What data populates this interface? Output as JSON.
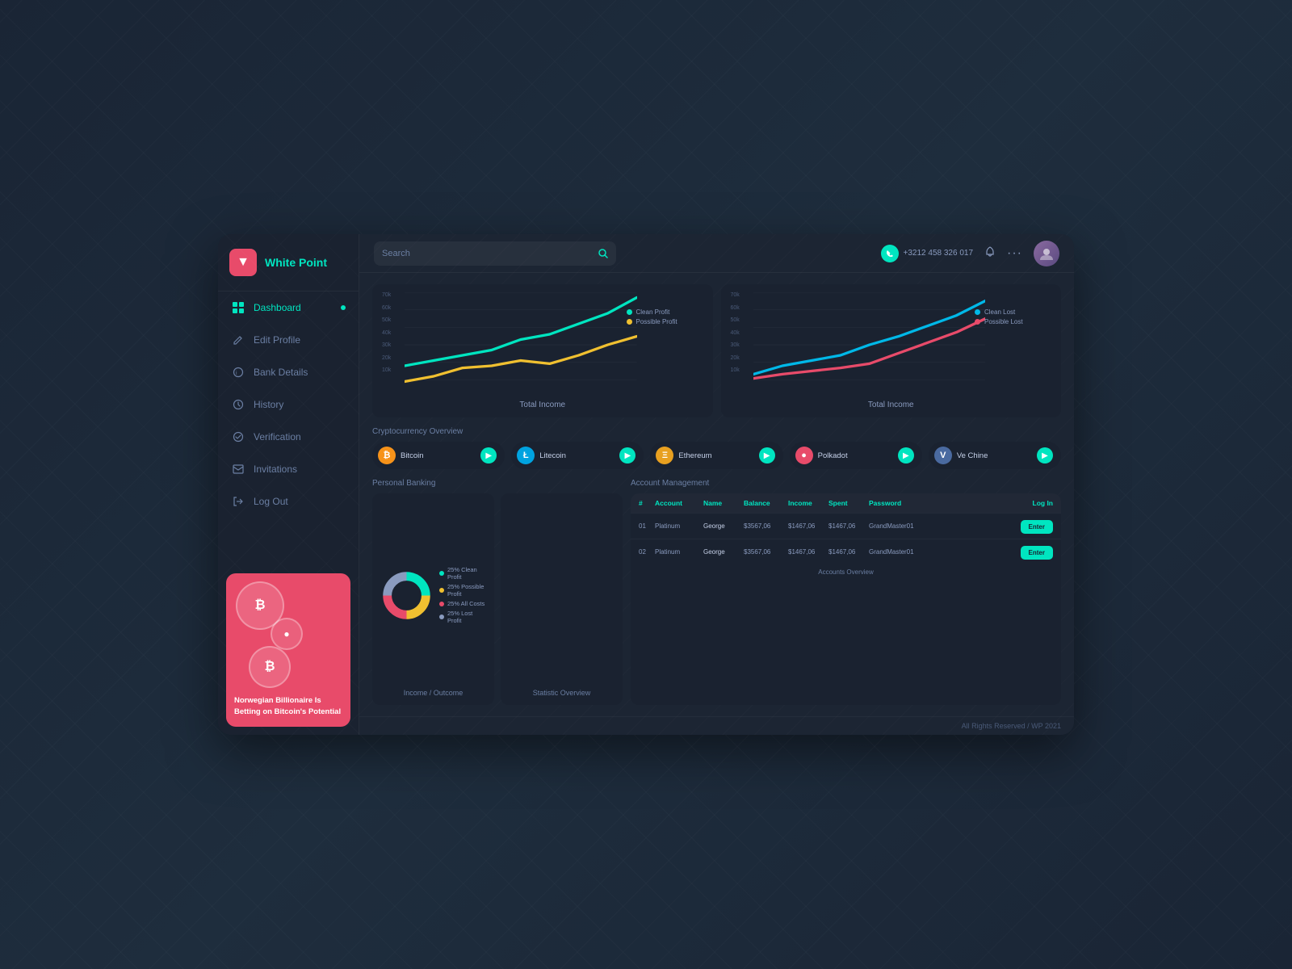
{
  "app": {
    "title": "White Point",
    "logo_symbol": "▼",
    "footer": "All Rights Reserved / WP 2021"
  },
  "topbar": {
    "search_placeholder": "Search",
    "phone": "+3212 458 326 017",
    "dots": "···"
  },
  "nav": {
    "items": [
      {
        "label": "Dashboard",
        "icon": "📊",
        "active": true
      },
      {
        "label": "Edit Profile",
        "icon": "✏️",
        "active": false
      },
      {
        "label": "Bank Details",
        "icon": "ℹ️",
        "active": false
      },
      {
        "label": "History",
        "icon": "🕐",
        "active": false
      },
      {
        "label": "Verification",
        "icon": "✅",
        "active": false
      },
      {
        "label": "Invitations",
        "icon": "📋",
        "active": false
      },
      {
        "label": "Log Out",
        "icon": "◀",
        "active": false
      }
    ]
  },
  "promo": {
    "text": "Norwegian Billionaire Is Betting on Bitcoin's Potential"
  },
  "charts": {
    "income_left": {
      "title": "Total Income",
      "legend": [
        {
          "label": "Clean Profit",
          "color": "#00e5c0"
        },
        {
          "label": "Possible Profit",
          "color": "#f0c030"
        }
      ],
      "y_labels": [
        "70k",
        "60k",
        "50k",
        "40k",
        "30k",
        "20k",
        "10k"
      ]
    },
    "income_right": {
      "title": "Total Income",
      "legend": [
        {
          "label": "Clean Lost",
          "color": "#00b8e8"
        },
        {
          "label": "Possible Lost",
          "color": "#e84b6a"
        }
      ],
      "y_labels": [
        "70k",
        "60k",
        "50k",
        "40k",
        "30k",
        "20k",
        "10k"
      ]
    }
  },
  "crypto": {
    "section_title": "Cryptocurrency Overview",
    "items": [
      {
        "name": "Bitcoin",
        "symbol": "₿",
        "color": "#f7931a"
      },
      {
        "name": "Litecoin",
        "symbol": "Ł",
        "color": "#00a3e0"
      },
      {
        "name": "Ethereum",
        "symbol": "Ξ",
        "color": "#e8a020"
      },
      {
        "name": "Polkadot",
        "symbol": "●",
        "color": "#e84b6a"
      },
      {
        "name": "Ve Chine",
        "symbol": "V",
        "color": "#4a6aa0"
      }
    ]
  },
  "personal_banking": {
    "title": "Personal Banking",
    "income_outcome": {
      "title": "Income / Outcome",
      "legend": [
        {
          "label": "25% Clean Profit",
          "color": "#00e5c0"
        },
        {
          "label": "25% Possible Profit",
          "color": "#f0c030"
        },
        {
          "label": "25% All Costs",
          "color": "#e84b6a"
        },
        {
          "label": "25% Lost Profit",
          "color": "#8a9bbf"
        }
      ]
    },
    "statistic": {
      "title": "Statistic Overview"
    }
  },
  "account_management": {
    "title": "Account Management",
    "columns": [
      "#",
      "Account",
      "Name",
      "Balance",
      "Income",
      "Spent",
      "Password",
      "Log In"
    ],
    "rows": [
      {
        "id": "01",
        "account": "Platinum",
        "name": "George",
        "balance": "$3567,06",
        "income": "$1467,06",
        "spent": "$1467,06",
        "password": "GrandMaster01",
        "action": "Enter"
      },
      {
        "id": "02",
        "account": "Platinum",
        "name": "George",
        "balance": "$3567,06",
        "income": "$1467,06",
        "spent": "$1467,06",
        "password": "GrandMaster01",
        "action": "Enter"
      }
    ],
    "footer": "Accounts Overview"
  }
}
